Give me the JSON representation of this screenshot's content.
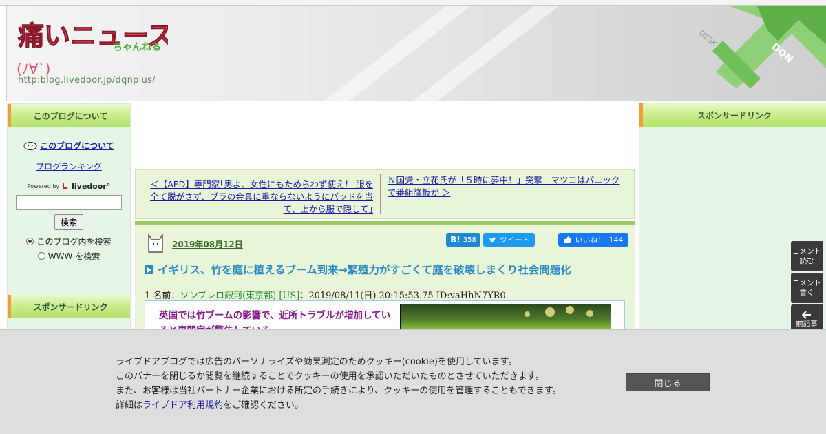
{
  "header": {
    "logo_main": "痛いニュース",
    "logo_small": "ちゃんねる",
    "logo_face": "(ﾉ∀`)",
    "logo_url": "http:blog.livedoor.jp/dqnplus/"
  },
  "left_sidebar": {
    "heading": "このブログについて",
    "about_link": "このブログについて",
    "ranking_link": "ブログランキング",
    "powered_by": "Powered by",
    "powered_brand": "livedoor°",
    "search_placeholder": "",
    "search_button": "検索",
    "radio_options": [
      "このブログ内を検索",
      "WWW を検索"
    ],
    "sponsor_heading": "スポンサードリンク"
  },
  "right_sidebar": {
    "heading": "スポンサードリンク"
  },
  "nav": {
    "prev_link": "＜【AED】専門家｢男よ、女性にもためらわず使え！ 服を全て脱がさず、ブラの金具に重ならないようにパッドを当て、上から服で隠して｣",
    "next_link": "Ｎ国党・立花氏が「５時に夢中！」突撃　マツコはパニックで番組降板か ＞"
  },
  "post": {
    "date": "2019年08月12日",
    "hatena_label": "B!",
    "hatena_count": "358",
    "tweet_label": "ツイート",
    "fb_label": "いいね！",
    "fb_count": "144",
    "title": "イギリス、竹を庭に植えるブーム到来→繁殖力がすごくて庭を破壊しまくり社会問題化",
    "res_number": "1",
    "res_name_label": "名前：",
    "res_name": "ソンブレロ銀河(東京都) [US]",
    "res_meta": "：2019/08/11(日) 20:15:53.75 ID:vaHhN7YR0",
    "quote": "英国では竹ブームの影響で、近所トラブルが増加していると専門家が警告している。"
  },
  "float_buttons": [
    {
      "line1": "コメント",
      "line2": "読む"
    },
    {
      "line1": "コメント",
      "line2": "書く"
    },
    {
      "line1": "",
      "line2": "前記事"
    }
  ],
  "cookie": {
    "line1": "ライブドアブログでは広告のパーソナライズや効果測定のためクッキー(cookie)を使用しています。",
    "line2": "このバナーを閉じるか閲覧を継続することでクッキーの使用を承認いただいたものとさせていただきます。",
    "line3": "また、お客様は当社パートナー企業における所定の手続きにより、クッキーの使用を管理することもできます。",
    "line4_prefix": "詳細は",
    "line4_link": "ライブドア利用規約",
    "line4_suffix": "をご確認ください。",
    "close_button": "閉じる"
  }
}
